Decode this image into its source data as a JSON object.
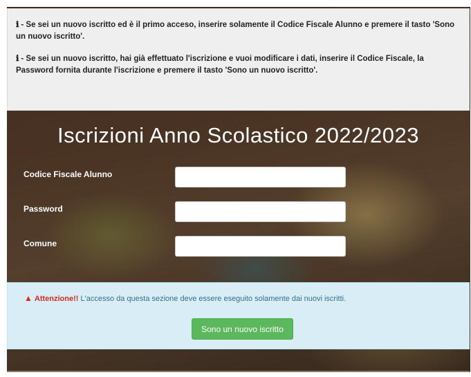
{
  "info": {
    "line1": "- Se sei un nuovo iscritto ed è il primo acceso, inserire solamente il Codice Fiscale Alunno e premere il tasto 'Sono un nuovo iscritto'.",
    "line2": "- Se sei un nuovo iscritto, hai già effettuato l'iscrizione e vuoi modificare i dati, inserire il Codice Fiscale, la Password fornita durante l'iscrizione e premere il tasto 'Sono un nuovo iscritto'.",
    "icon": "info-icon"
  },
  "title": "Iscrizioni Anno Scolastico 2022/2023",
  "form": {
    "codice_fiscale_label": "Codice Fiscale Alunno",
    "codice_fiscale_value": "",
    "password_label": "Password",
    "password_value": "",
    "comune_label": "Comune",
    "comune_value": ""
  },
  "alert": {
    "icon": "warning-icon",
    "strong": "Attenzione!!",
    "text": " L'accesso da questa sezione deve essere eseguito solamente dai nuovi iscritti.",
    "button_label": "Sono un nuovo iscritto"
  },
  "colors": {
    "button": "#5cb85c",
    "alert_bg": "#d9edf7",
    "alert_text": "#31708f",
    "warning": "#d9281e"
  }
}
